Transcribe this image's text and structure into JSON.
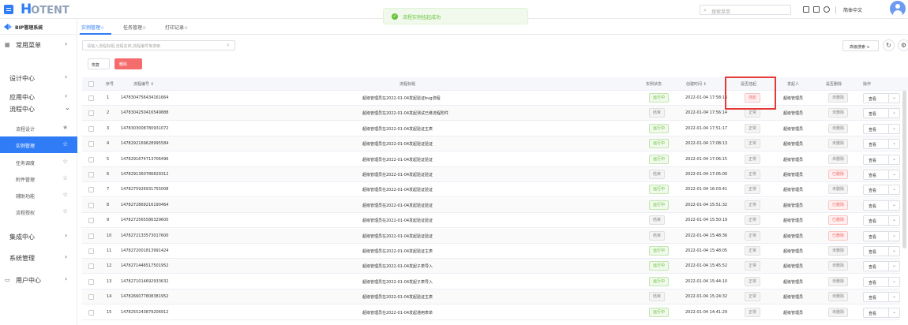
{
  "header": {
    "logo_main": "H",
    "logo_rest": "OTENT",
    "toast": "流程实例挂起成功",
    "search_placeholder": "搜索菜单",
    "language": "简体中文"
  },
  "sidebar": {
    "system_title": "BIP管理系统",
    "items": [
      {
        "label": "常用菜单"
      },
      {
        "label": "设计中心"
      },
      {
        "label": "应用中心"
      },
      {
        "label": "流程中心"
      }
    ],
    "sub_items": [
      {
        "label": "流程设计"
      },
      {
        "label": "实例管理"
      },
      {
        "label": "任务调度"
      },
      {
        "label": "附件管理"
      },
      {
        "label": "辅助功能"
      },
      {
        "label": "流程授权"
      }
    ],
    "bottom_items": [
      {
        "label": "集成中心"
      },
      {
        "label": "系统管理"
      },
      {
        "label": "用户中心"
      }
    ]
  },
  "tabs": [
    {
      "label": "实例管理☆"
    },
    {
      "label": "任务管理☆"
    },
    {
      "label": "打印记录☆"
    }
  ],
  "filter": {
    "placeholder": "请输入流程标题,流程名称,流程编号等搜索",
    "advanced_search": "高级搜索 ∨",
    "restore_btn": "恢复",
    "delete_btn": "删除"
  },
  "table": {
    "headers": {
      "index": "序号",
      "code": "流程编号 ⇕",
      "title": "流程标题",
      "state": "实例状态",
      "created": "创建时间 ⇕",
      "suspended": "是否挂起",
      "initiator": "发起人",
      "deleted": "是否删除",
      "action": "操作"
    },
    "view_label": "查看",
    "rows": [
      {
        "idx": "1",
        "code": "1478304756434161664",
        "title": "超级管理员在2022-01-04发起验证bug流程",
        "state": "运行中",
        "created": "2022-01-04 17:58:14",
        "suspended": "挂起",
        "initiator": "超级管理员",
        "deleted": "未删除"
      },
      {
        "idx": "2",
        "code": "1478304250416549888",
        "title": "超级管理员在2022-01-04发起测试已移流程附件",
        "state": "结束",
        "created": "2022-01-04 17:56:14",
        "suspended": "正常",
        "initiator": "超级管理员",
        "deleted": "未删除"
      },
      {
        "idx": "3",
        "code": "1478303008780931072",
        "title": "超级管理员在2022-01-04发起验证主表",
        "state": "运行中",
        "created": "2022-01-04 17:51:17",
        "suspended": "正常",
        "initiator": "超级管理员",
        "deleted": "未删除"
      },
      {
        "idx": "4",
        "code": "1478292169628995584",
        "title": "超级管理员在2022-01-04发起验证验证",
        "state": "运行中",
        "created": "2022-01-04 17:08:13",
        "suspended": "正常",
        "initiator": "超级管理员",
        "deleted": "未删除"
      },
      {
        "idx": "5",
        "code": "1478291674713706496",
        "title": "超级管理员在2022-01-04发起验证验证",
        "state": "运行中",
        "created": "2022-01-04 17:06:15",
        "suspended": "正常",
        "initiator": "超级管理员",
        "deleted": "未删除"
      },
      {
        "idx": "6",
        "code": "1478291360786829312",
        "title": "超级管理员在2022-01-04发起验证验证",
        "state": "结束",
        "created": "2022-01-04 17:05:00",
        "suspended": "正常",
        "initiator": "超级管理员",
        "deleted": "已删除"
      },
      {
        "idx": "7",
        "code": "1478275926931755008",
        "title": "超级管理员在2022-01-04发起验证验证",
        "state": "运行中",
        "created": "2022-01-04 16:03:41",
        "suspended": "正常",
        "initiator": "超级管理员",
        "deleted": "未删除"
      },
      {
        "idx": "8",
        "code": "1478272869216190464",
        "title": "超级管理员在2022-01-04发起验证验证",
        "state": "运行中",
        "created": "2022-01-04 15:51:32",
        "suspended": "正常",
        "initiator": "超级管理员",
        "deleted": "已删除"
      },
      {
        "idx": "9",
        "code": "1478272565586329600",
        "title": "超级管理员在2022-01-04发起验证验证",
        "state": "结束",
        "created": "2022-01-04 15:50:19",
        "suspended": "正常",
        "initiator": "超级管理员",
        "deleted": "已删除"
      },
      {
        "idx": "10",
        "code": "1478272133573017600",
        "title": "超级管理员在2022-01-04发起验证验证",
        "state": "结束",
        "created": "2022-01-04 15:48:36",
        "suspended": "正常",
        "initiator": "超级管理员",
        "deleted": "已删除"
      },
      {
        "idx": "11",
        "code": "1478272001813991424",
        "title": "超级管理员在2022-01-04发起验证主表",
        "state": "运行中",
        "created": "2022-01-04 15:48:05",
        "suspended": "正常",
        "initiator": "超级管理员",
        "deleted": "未删除"
      },
      {
        "idx": "12",
        "code": "1478271446517501952",
        "title": "超级管理员在2022-01-04发起子表导入",
        "state": "运行中",
        "created": "2022-01-04 15:45:52",
        "suspended": "正常",
        "initiator": "超级管理员",
        "deleted": "未删除"
      },
      {
        "idx": "13",
        "code": "1478271014692933632",
        "title": "超级管理员在2022-01-04发起子表导入",
        "state": "运行中",
        "created": "2022-01-04 15:44:10",
        "suspended": "正常",
        "initiator": "超级管理员",
        "deleted": "未删除"
      },
      {
        "idx": "14",
        "code": "1478266077808381952",
        "title": "超级管理员在2022-01-04发起验证主表",
        "state": "结束",
        "created": "2022-01-04 15:24:32",
        "suspended": "正常",
        "initiator": "超级管理员",
        "deleted": "未删除"
      },
      {
        "idx": "15",
        "code": "1478255243879206912",
        "title": "超级管理员在2022-01-04发起通用表单",
        "state": "运行中",
        "created": "2022-01-04 14:41:29",
        "suspended": "正常",
        "initiator": "超级管理员",
        "deleted": "未删除"
      }
    ]
  },
  "colors": {
    "primary": "#2f7cf6",
    "success": "#67c23a",
    "danger": "#f56c6c",
    "highlight": "#e53935"
  },
  "icons": [
    "menu-icon",
    "search-icon",
    "fullscreen-icon",
    "layout-icon",
    "refresh-icon",
    "settings-icon",
    "avatar",
    "grid-icon",
    "user-icon",
    "chevron-right-icon",
    "chevron-down-icon",
    "star-icon",
    "check-icon"
  ]
}
